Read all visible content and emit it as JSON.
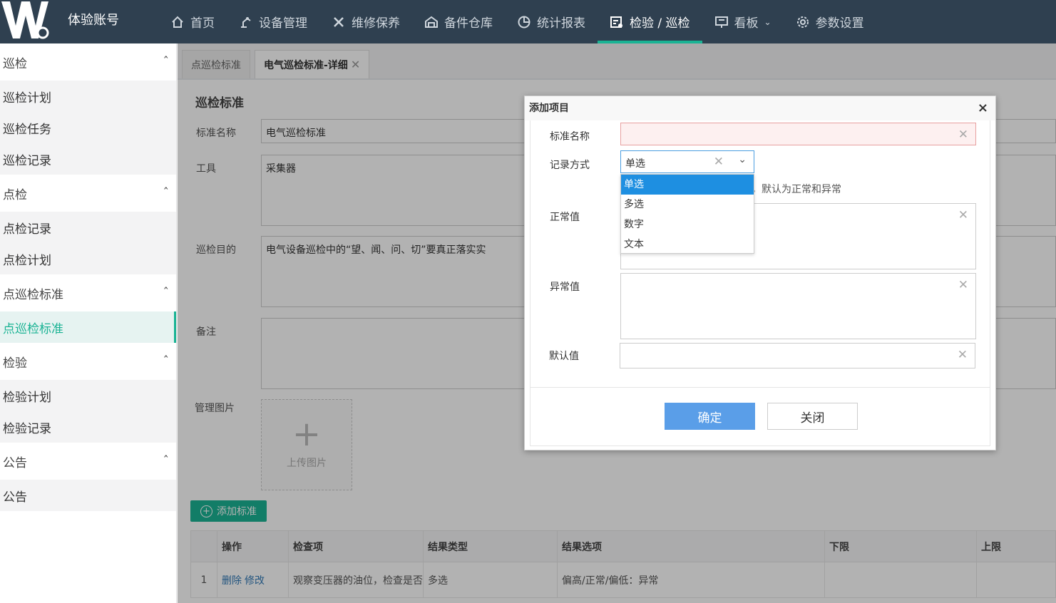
{
  "header": {
    "account": "体验账号",
    "nav": [
      {
        "label": "首页",
        "icon": "home-icon"
      },
      {
        "label": "设备管理",
        "icon": "robot-arm-icon"
      },
      {
        "label": "维修保养",
        "icon": "tools-icon"
      },
      {
        "label": "备件仓库",
        "icon": "warehouse-icon"
      },
      {
        "label": "统计报表",
        "icon": "pie-chart-icon"
      },
      {
        "label": "检验 / 巡检",
        "icon": "inspection-icon",
        "active": true
      },
      {
        "label": "看板",
        "icon": "board-icon",
        "dropdown": true
      },
      {
        "label": "参数设置",
        "icon": "gear-icon"
      }
    ]
  },
  "sidebar": {
    "groups": [
      {
        "label": "巡检",
        "items": [
          "巡检计划",
          "巡检任务",
          "巡检记录"
        ]
      },
      {
        "label": "点检",
        "items": [
          "点检记录",
          "点检计划"
        ]
      },
      {
        "label": "点巡检标准",
        "items": [
          "点巡检标准"
        ]
      },
      {
        "label": "检验",
        "items": [
          "检验计划",
          "检验记录"
        ]
      },
      {
        "label": "公告",
        "items": [
          "公告"
        ]
      }
    ]
  },
  "tabs": [
    {
      "label": "点巡检标准"
    },
    {
      "label": "电气巡检标准-详细",
      "close": "✕"
    }
  ],
  "form": {
    "section_title": "巡检标准",
    "name_label": "标准名称",
    "name_value": "电气巡检标准",
    "tool_label": "工具",
    "tool_value": "采集器",
    "purpose_label": "巡检目的",
    "purpose_value": "电气设备巡检中的“望、闻、问、切”要真正落实实",
    "remark_label": "备注",
    "image_label": "管理图片",
    "upload_plus": "+",
    "upload_text": "上传图片",
    "add_button": "添加标准"
  },
  "table": {
    "headers": [
      "",
      "操作",
      "检查项",
      "结果类型",
      "结果选项",
      "下限",
      "上限"
    ],
    "rows": [
      {
        "index": "1",
        "delete": "删除",
        "edit": "修改",
        "item": "观察变压器的油位，检查是否",
        "type": "多选",
        "options": "偏高/正常/偏低：异常",
        "lower": "",
        "upper": ""
      }
    ]
  },
  "modal": {
    "title": "添加项目",
    "close": "×",
    "name_label": "标准名称",
    "record_label": "记录方式",
    "record_value": "单选",
    "hint": "，默认为正常和异常",
    "normal_label": "正常值",
    "abnormal_label": "异常值",
    "default_label": "默认值",
    "options": [
      "单选",
      "多选",
      "数字",
      "文本"
    ],
    "ok": "确定",
    "cancel": "关闭"
  },
  "colors": {
    "topbar": "#2f4050",
    "accent": "#1ab394",
    "primary": "#5a9ee8"
  }
}
